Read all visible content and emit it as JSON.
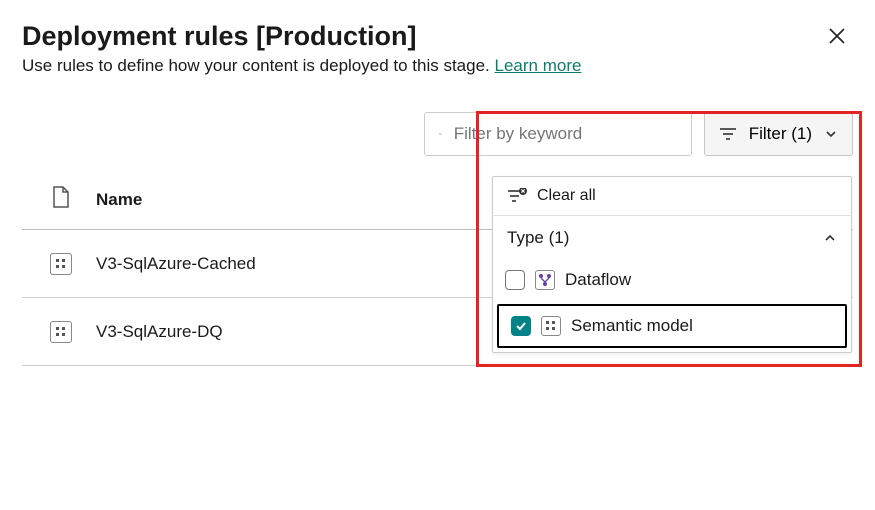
{
  "header": {
    "title": "Deployment rules [Production]",
    "subtitle": "Use rules to define how your content is deployed to this stage.",
    "learn_more": "Learn more"
  },
  "toolbar": {
    "search_placeholder": "Filter by keyword",
    "filter_button": "Filter (1)"
  },
  "table": {
    "name_header": "Name",
    "rows": [
      {
        "name": "V3-SqlAzure-Cached"
      },
      {
        "name": "V3-SqlAzure-DQ"
      }
    ]
  },
  "filter_panel": {
    "clear_all": "Clear all",
    "type_header": "Type (1)",
    "options": [
      {
        "label": "Dataflow",
        "checked": false
      },
      {
        "label": "Semantic model",
        "checked": true
      }
    ]
  },
  "colors": {
    "accent_teal": "#038387",
    "link_green": "#0f7b6c",
    "highlight_red": "#e32424"
  }
}
